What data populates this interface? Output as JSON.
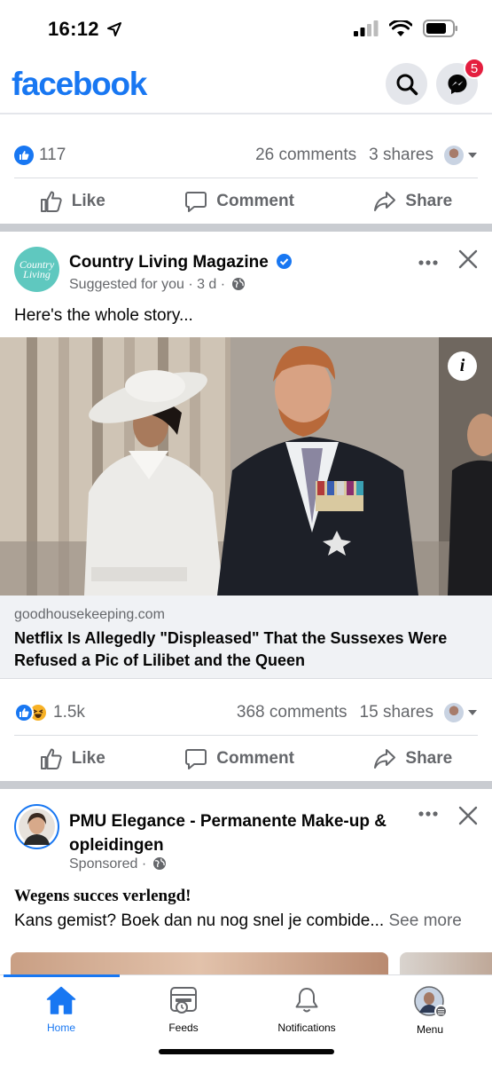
{
  "status": {
    "time": "16:12"
  },
  "header": {
    "logo": "facebook",
    "messenger_badge": "5"
  },
  "post1_footer": {
    "reactions": "117",
    "comments": "26 comments",
    "shares": "3 shares"
  },
  "actions": {
    "like": "Like",
    "comment": "Comment",
    "share": "Share"
  },
  "post2": {
    "page_name": "Country Living Magazine",
    "avatar_text": "Country Living",
    "meta": "Suggested for you · 3 d ·",
    "text": "Here's the whole story...",
    "link_domain": "goodhousekeeping.com",
    "link_title": "Netflix Is Allegedly \"Displeased\" That the Sussexes Were Refused a Pic of Lilibet and the Queen",
    "reactions": "1.5k",
    "comments": "368 comments",
    "shares": "15 shares"
  },
  "post3": {
    "page_name": "PMU Elegance - Permanente Make-up & opleidingen",
    "meta": "Sponsored ·",
    "headline": "Wegens succes verlengd!",
    "text": "Kans gemist? Boek dan nu nog snel je combide...",
    "see_more": "See more"
  },
  "tabs": [
    {
      "label": "Home"
    },
    {
      "label": "Feeds"
    },
    {
      "label": "Notifications"
    },
    {
      "label": "Menu"
    }
  ],
  "colors": {
    "brand": "#1877f2",
    "badge": "#e41e3f",
    "separator": "#c9ccd1"
  }
}
